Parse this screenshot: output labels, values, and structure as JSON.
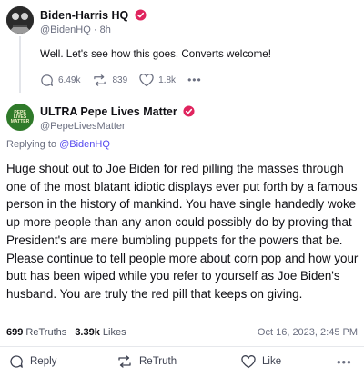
{
  "parent": {
    "name": "Biden-Harris HQ",
    "handle": "@BidenHQ",
    "separator": "·",
    "time": "8h",
    "text": "Well. Let's see how this goes. Converts welcome!",
    "stats": {
      "replies": "6.49k",
      "retruths": "839",
      "likes": "1.8k"
    },
    "more": "•••"
  },
  "reply": {
    "avatar_text": "PEPE LIVES MATTER",
    "name": "ULTRA Pepe Lives Matter",
    "handle": "@PepeLivesMatter",
    "replying_prefix": "Replying to",
    "replying_handle": "@BidenHQ",
    "body": "Huge shout out to Joe Biden for red pilling the masses through one of the most blatant idiotic displays ever put forth by a famous person in the history of mankind. You have single handedly woke up more people than any anon could possibly do by proving that President's are mere bumbling puppets for the powers that be. Please continue to tell people more about corn pop and how your butt has been wiped while you refer to yourself as Joe Biden's husband. You are truly the red pill that keeps on giving.",
    "retruths_count": "699",
    "retruths_label": "ReTruths",
    "likes_count": "3.39k",
    "likes_label": "Likes",
    "timestamp": "Oct 16, 2023, 2:45 PM"
  },
  "actions": {
    "reply_label": "Reply",
    "retruth_label": "ReTruth",
    "like_label": "Like",
    "more": "•••"
  },
  "colors": {
    "verified": "#e0245e",
    "link": "#5448ee",
    "muted": "#6b6f80"
  },
  "icons": [
    "verified-badge-icon",
    "comment-icon",
    "retruth-icon",
    "heart-icon",
    "more-icon"
  ]
}
